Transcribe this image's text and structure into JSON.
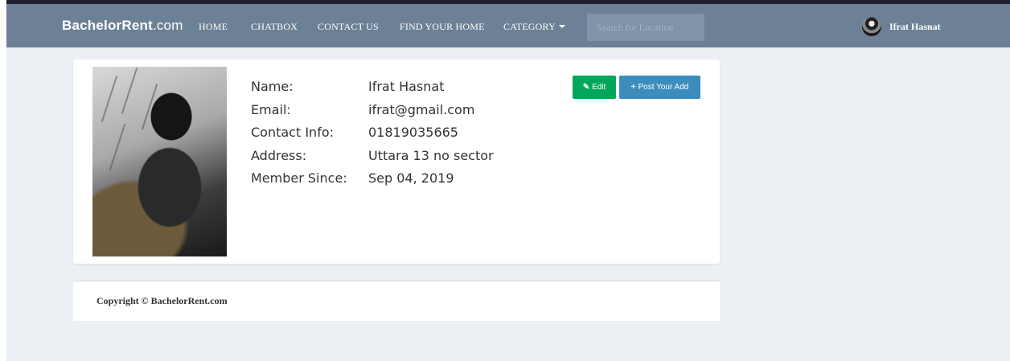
{
  "navbar": {
    "brand_bold": "BachelorRent",
    "brand_suffix": ".com",
    "links": [
      "HOME",
      "CHATBOX",
      "CONTACT US",
      "FIND YOUR HOME",
      "CATEGORY"
    ],
    "search_placeholder": "Search for Location",
    "user_name": "Ifrat Hasnat"
  },
  "profile": {
    "labels": [
      "Name:",
      "Email:",
      "Contact Info:",
      "Address:",
      "Member Since:"
    ],
    "values": [
      "Ifrat Hasnat",
      "ifrat@gmail.com",
      "01819035665",
      "Uttara 13 no sector",
      "Sep 04, 2019"
    ],
    "edit_label": "Edit",
    "post_label": "Post Your Add"
  },
  "footer": {
    "copyright": "Copyright © BachelorRent.com"
  },
  "colors": {
    "navbar": "#6d8196",
    "background": "#ecf0f5",
    "edit_button": "#00a65a",
    "post_button": "#3c8dbc"
  },
  "icons": {
    "edit": "edit-icon",
    "post": "plus-icon",
    "category": "caret-down-icon",
    "user": "user-avatar"
  }
}
